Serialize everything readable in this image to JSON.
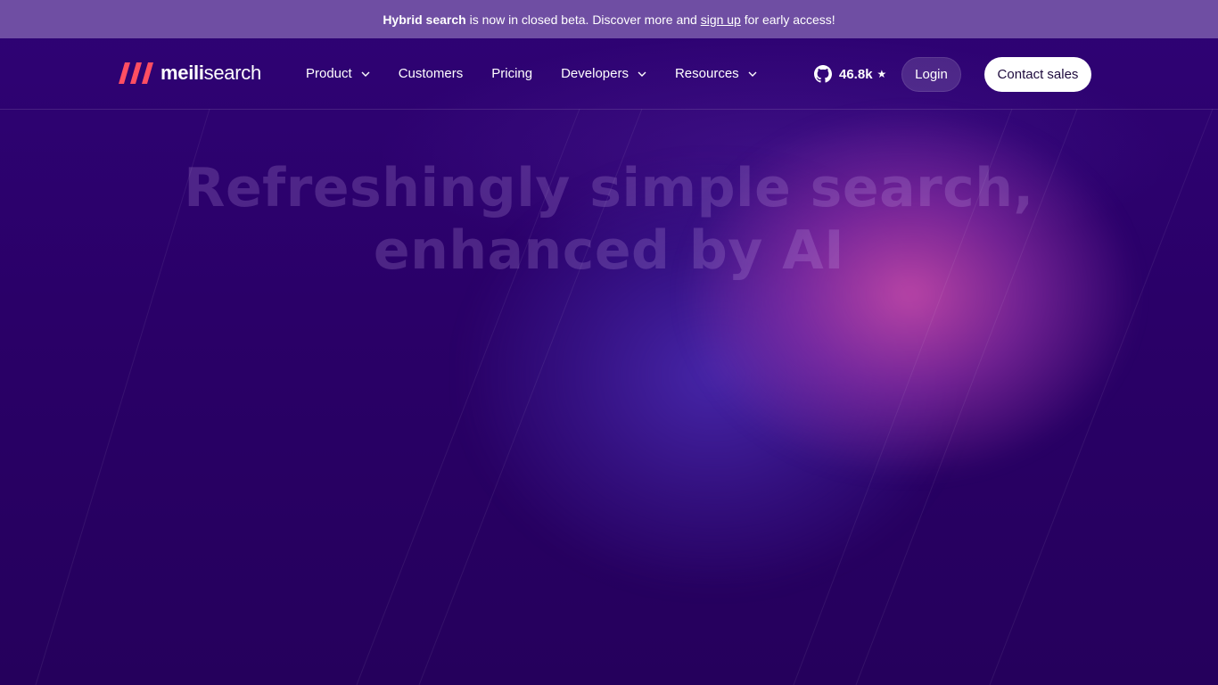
{
  "banner": {
    "strong": "Hybrid search",
    "text1": " is now in closed beta. Discover more and ",
    "link": "sign up",
    "text2": " for early access!"
  },
  "brand": {
    "name_bold": "meili",
    "name_regular": "search",
    "accent": "#ff4e62"
  },
  "nav": {
    "items": [
      {
        "label": "Product",
        "has_dropdown": true
      },
      {
        "label": "Customers",
        "has_dropdown": false
      },
      {
        "label": "Pricing",
        "has_dropdown": false
      },
      {
        "label": "Developers",
        "has_dropdown": true
      },
      {
        "label": "Resources",
        "has_dropdown": true
      }
    ],
    "github_stars": "46.8k",
    "star_glyph": "★",
    "login_label": "Login",
    "contact_label": "Contact sales"
  },
  "hero": {
    "title_line1": "Refreshingly simple search,",
    "title_line2": "enhanced by AI"
  },
  "colors": {
    "background": "#2a0068",
    "banner": "#6f4ea3",
    "glow_pink": "#d250af",
    "glow_blue": "#5032be"
  }
}
